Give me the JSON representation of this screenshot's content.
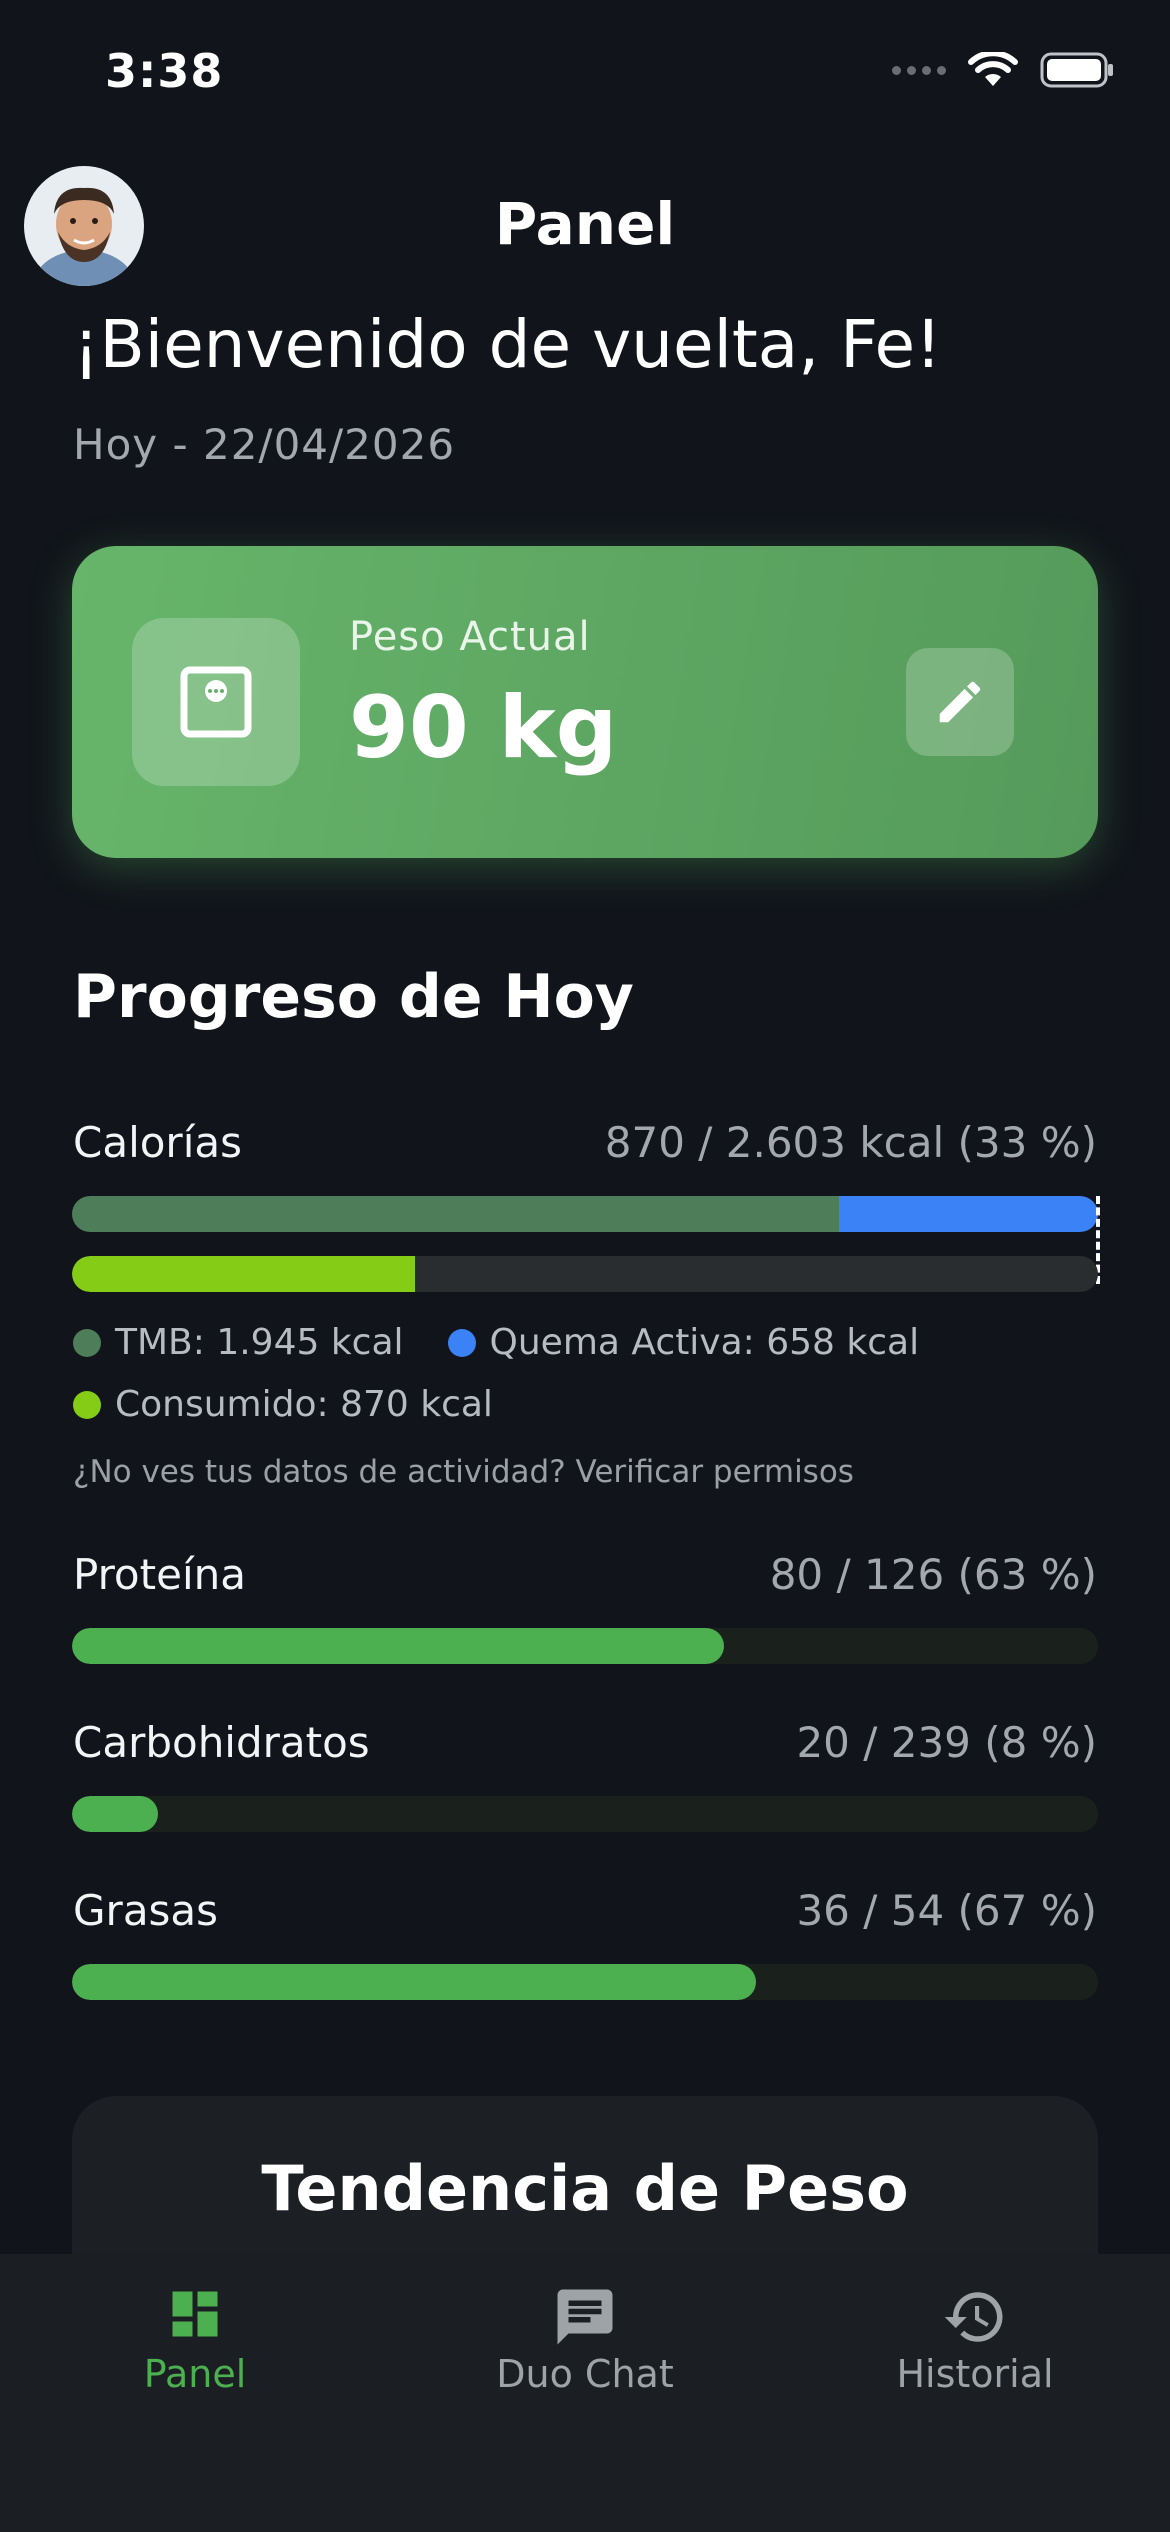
{
  "status_bar": {
    "time": "3:38"
  },
  "header": {
    "title": "Panel"
  },
  "welcome": "¡Bienvenido de vuelta, Fe!",
  "date": "Hoy - 22/04/2026",
  "weight_card": {
    "label": "Peso Actual",
    "value": "90 kg"
  },
  "progress": {
    "title": "Progreso de Hoy",
    "calories": {
      "label": "Calorías",
      "value": "870 / 2.603 kcal (33 %)",
      "bmr_fraction": 0.748,
      "active_fraction": 0.252,
      "consumed_fraction": 0.334,
      "legend": {
        "bmr": "TMB: 1.945 kcal",
        "active": "Quema Activa: 658 kcal",
        "consumed": "Consumido: 870 kcal"
      },
      "colors": {
        "bmr": "#4e7d5a",
        "active": "#3b82f6",
        "consumed": "#84cc16"
      },
      "permissions_link": "¿No ves tus datos de actividad? Verificar permisos"
    },
    "macros": [
      {
        "label": "Proteína",
        "value": "80 / 126 (63 %)",
        "fraction": 0.635
      },
      {
        "label": "Carbohidratos",
        "value": "20 / 239 (8 %)",
        "fraction": 0.084
      },
      {
        "label": "Grasas",
        "value": "36 / 54 (67 %)",
        "fraction": 0.667
      }
    ]
  },
  "trend": {
    "title": "Tendencia de Peso"
  },
  "tabs": [
    {
      "label": "Panel",
      "icon": "dashboard-icon",
      "active": true
    },
    {
      "label": "Duo Chat",
      "icon": "chat-icon",
      "active": false
    },
    {
      "label": "Historial",
      "icon": "history-icon",
      "active": false
    }
  ],
  "colors": {
    "accent": "#4caf50",
    "background": "#11151b",
    "card": "#5da662"
  }
}
